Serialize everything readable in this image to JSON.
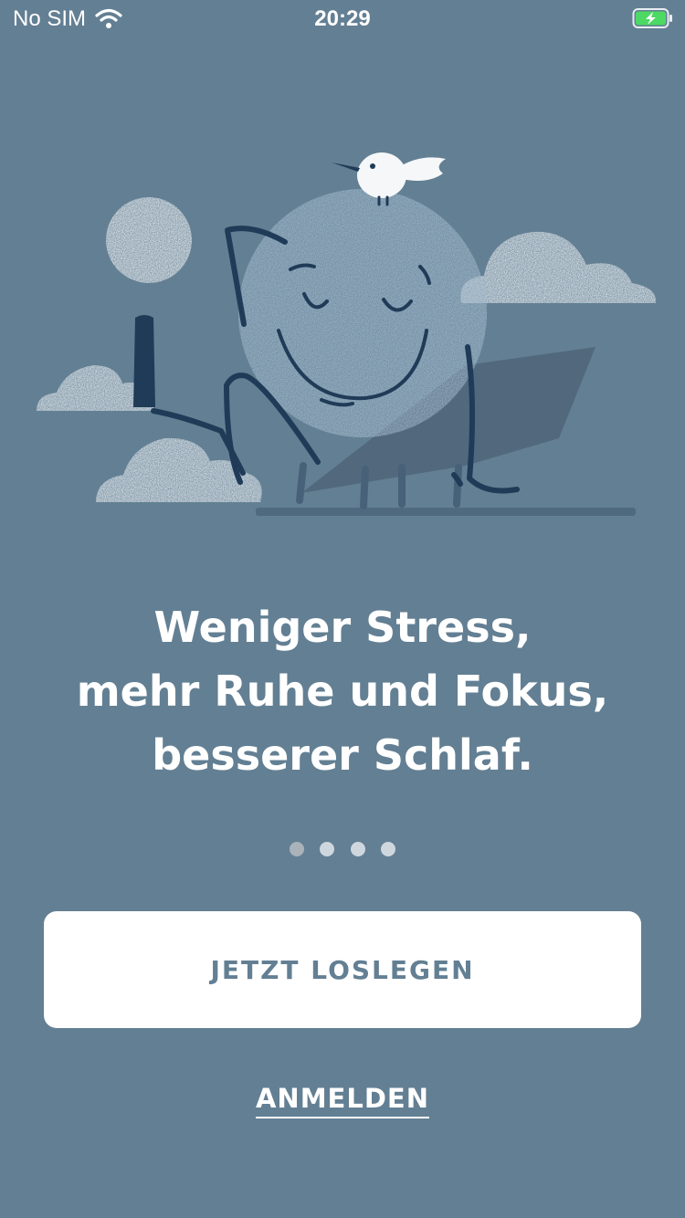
{
  "status_bar": {
    "carrier": "No SIM",
    "time": "20:29",
    "wifi_icon": "wifi-icon",
    "battery_icon": "battery-charging-icon",
    "battery_color": "#4cd964"
  },
  "onboarding": {
    "illustration": "meditating-moon-character-with-bird-and-clouds",
    "headline": {
      "line1": "Weniger Stress,",
      "line2": "mehr Ruhe und Fokus,",
      "line3": "besserer Schlaf."
    },
    "pager": {
      "total": 4,
      "current": 1
    },
    "primary_button": "JETZT LOSLEGEN",
    "secondary_link": "ANMELDEN"
  },
  "colors": {
    "background": "#637f93",
    "button_background": "#ffffff",
    "button_text": "#637f93",
    "moon": "#a5bcd0",
    "ink": "#1f3b57"
  }
}
